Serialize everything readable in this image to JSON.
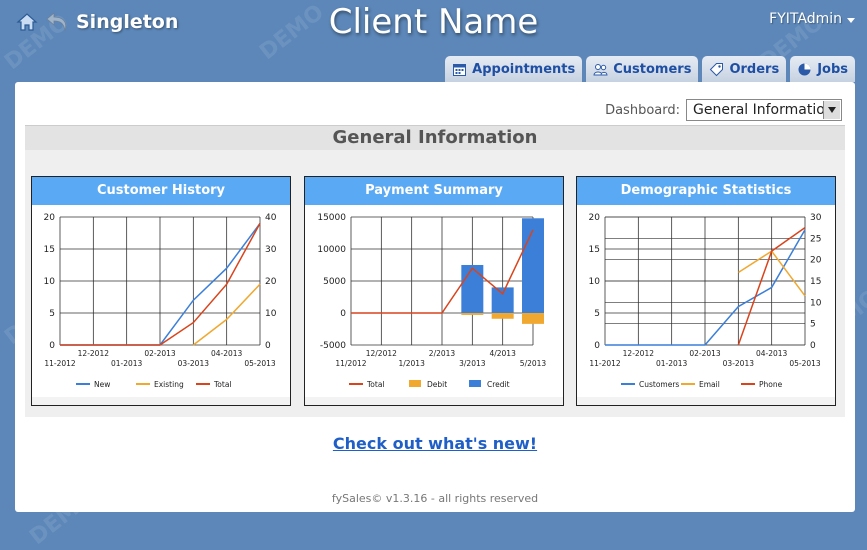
{
  "header": {
    "app_name": "Singleton",
    "client_name": "Client Name",
    "user": "FYITAdmin",
    "watermark": "DEMO"
  },
  "tabs": [
    {
      "label": "Appointments",
      "icon": "calendar-icon"
    },
    {
      "label": "Customers",
      "icon": "users-icon"
    },
    {
      "label": "Orders",
      "icon": "tag-icon"
    },
    {
      "label": "Jobs",
      "icon": "pie-icon"
    }
  ],
  "dashboard": {
    "label": "Dashboard:",
    "selected": "General Information"
  },
  "section_title": "General Information",
  "links": {
    "whats_new": "Check out what's new!"
  },
  "footer": "fySales© v1.3.16 - all rights reserved",
  "colors": {
    "blue": "#3b7fd9",
    "orange": "#f0a830",
    "red": "#d9441c",
    "title": "#5aa9f4"
  },
  "chart_data": [
    {
      "type": "line",
      "title": "Customer History",
      "x_top": [
        "12-2012",
        "02-2013",
        "04-2013"
      ],
      "x_bottom": [
        "11-2012",
        "01-2013",
        "03-2013",
        "05-2013"
      ],
      "x": [
        "11-2012",
        "12-2012",
        "01-2013",
        "02-2013",
        "03-2013",
        "04-2013",
        "05-2013"
      ],
      "y_left": {
        "min": 0,
        "max": 20,
        "ticks": [
          0,
          5,
          10,
          15,
          20
        ]
      },
      "y_right": {
        "min": 0,
        "max": 40,
        "ticks": [
          0,
          10,
          20,
          30,
          40
        ]
      },
      "series": [
        {
          "name": "New",
          "axis": "left",
          "color": "#3b7fd9",
          "values": [
            0,
            0,
            0,
            0,
            7,
            12,
            19
          ]
        },
        {
          "name": "Existing",
          "axis": "left",
          "color": "#f0a830",
          "values": [
            null,
            null,
            null,
            null,
            0,
            4,
            9.5
          ]
        },
        {
          "name": "Total",
          "axis": "right",
          "color": "#d9441c",
          "values": [
            0,
            0,
            0,
            0,
            7,
            19,
            38
          ]
        }
      ]
    },
    {
      "type": "bar",
      "title": "Payment Summary",
      "x_top": [
        "12/2012",
        "2/2013",
        "4/2013"
      ],
      "x_bottom": [
        "11/2012",
        "1/2013",
        "3/2013",
        "5/2013"
      ],
      "x": [
        "11/2012",
        "12/2012",
        "1/2013",
        "2/2013",
        "3/2013",
        "4/2013",
        "5/2013"
      ],
      "y_left": {
        "min": -5000,
        "max": 15000,
        "ticks": [
          -5000,
          0,
          5000,
          10000,
          15000
        ]
      },
      "series": [
        {
          "name": "Total",
          "kind": "line",
          "color": "#d9441c",
          "values": [
            0,
            0,
            0,
            0,
            7000,
            3000,
            13000
          ]
        },
        {
          "name": "Debit",
          "kind": "bar",
          "color": "#f0a830",
          "values": [
            0,
            0,
            0,
            0,
            -300,
            -900,
            -1700
          ]
        },
        {
          "name": "Credit",
          "kind": "bar",
          "color": "#3b7fd9",
          "values": [
            0,
            0,
            0,
            0,
            7500,
            4000,
            14800
          ]
        }
      ]
    },
    {
      "type": "line",
      "title": "Demographic Statistics",
      "x_top": [
        "12-2012",
        "02-2013",
        "04-2013"
      ],
      "x_bottom": [
        "11-2012",
        "01-2013",
        "03-2013",
        "05-2013"
      ],
      "x": [
        "11-2012",
        "12-2012",
        "01-2013",
        "02-2013",
        "03-2013",
        "04-2013",
        "05-2013"
      ],
      "y_left": {
        "min": 0,
        "max": 20,
        "ticks": [
          0,
          5,
          10,
          15,
          20
        ]
      },
      "y_right": {
        "min": 0,
        "max": 30,
        "ticks": [
          0,
          5,
          10,
          15,
          20,
          25,
          30
        ]
      },
      "series": [
        {
          "name": "Customers",
          "axis": "left",
          "color": "#3b7fd9",
          "values": [
            0,
            0,
            0,
            0,
            6,
            9,
            18
          ]
        },
        {
          "name": "Email",
          "axis": "right",
          "color": "#f0a830",
          "values": [
            null,
            null,
            null,
            null,
            17,
            22,
            11.5
          ]
        },
        {
          "name": "Phone",
          "axis": "right",
          "color": "#d9441c",
          "values": [
            null,
            null,
            null,
            null,
            0,
            22,
            27.5
          ]
        }
      ]
    }
  ]
}
